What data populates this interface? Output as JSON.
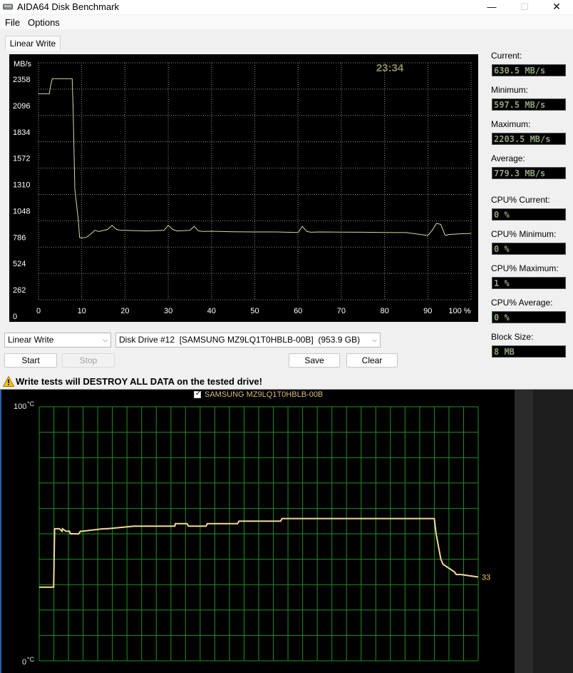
{
  "window": {
    "title": "AIDA64 Disk Benchmark",
    "minimize_glyph": "—",
    "maximize_glyph": "☐",
    "close_glyph": "✕"
  },
  "menu": {
    "file": "File",
    "options": "Options"
  },
  "tab": {
    "label": "Linear Write"
  },
  "chart_data": [
    {
      "type": "line",
      "ylabel": "MB/s",
      "timer": "23:34",
      "ylim": [
        0,
        2358
      ],
      "xlim": [
        0,
        100
      ],
      "y_ticks": [
        "2358",
        "2096",
        "1834",
        "1572",
        "1310",
        "1048",
        "786",
        "524",
        "262",
        "0"
      ],
      "x_ticks": [
        "0",
        "10",
        "20",
        "30",
        "40",
        "50",
        "60",
        "70",
        "80",
        "90",
        "100 %"
      ],
      "grid": true,
      "line_color": "#d8d8a0",
      "series": [
        {
          "x": [
            0,
            2.5,
            2.8,
            3.2,
            6,
            7.8,
            8.0,
            8.4,
            9.2,
            9.5,
            10,
            11,
            12,
            13,
            14,
            16,
            17,
            18,
            19,
            20,
            25,
            29,
            30,
            31,
            32,
            35,
            36,
            37,
            38,
            40,
            45,
            50,
            55,
            60,
            61,
            62,
            63,
            65,
            70,
            75,
            80,
            85,
            90,
            91,
            92,
            93,
            94,
            95,
            97,
            100
          ],
          "y": [
            2050,
            2050,
            2130,
            2200,
            2200,
            2200,
            1900,
            1100,
            800,
            620,
            615,
            620,
            650,
            690,
            680,
            700,
            740,
            700,
            690,
            690,
            685,
            690,
            740,
            700,
            685,
            690,
            730,
            685,
            680,
            682,
            676,
            675,
            675,
            670,
            730,
            680,
            672,
            675,
            673,
            672,
            670,
            668,
            640,
            690,
            760,
            750,
            640,
            650,
            655,
            660
          ]
        }
      ]
    },
    {
      "type": "line",
      "y_top_label": "100",
      "y_bottom_label": "0",
      "unit": "°C",
      "ylim": [
        0,
        100
      ],
      "grid": true,
      "line_color": "#f3d89a",
      "series": [
        {
          "name": "SAMSUNG MZ9LQ1T0HBLB-00B",
          "x": [
            0,
            3.3,
            3.5,
            4.6,
            5.2,
            5.3,
            6.1,
            6.9,
            7.1,
            9,
            9.4,
            9.5,
            9.8,
            14.6,
            14.8,
            15.5,
            21.6,
            21.8,
            30.9,
            31.0,
            33.7,
            34,
            38,
            38.3,
            45.2,
            45.5,
            55,
            55.3,
            89.5,
            90,
            90.4,
            91.5,
            92,
            94.6,
            95,
            96,
            100
          ],
          "y": [
            29,
            29,
            52,
            52,
            51,
            52,
            51,
            51,
            50,
            50,
            51,
            51,
            51,
            52,
            52,
            52,
            53,
            53,
            53,
            54,
            54,
            53,
            53,
            54,
            54,
            55,
            55,
            56,
            56,
            56,
            50,
            40,
            38,
            35,
            34,
            34,
            33
          ]
        }
      ],
      "current_value_label": "33"
    }
  ],
  "stats": {
    "current_label": "Current:",
    "current_value": "630.5 MB/s",
    "minimum_label": "Minimum:",
    "minimum_value": "597.5 MB/s",
    "maximum_label": "Maximum:",
    "maximum_value": "2203.5 MB/s",
    "average_label": "Average:",
    "average_value": "779.3 MB/s",
    "cpu_current_label": "CPU% Current:",
    "cpu_current_value": "0 %",
    "cpu_minimum_label": "CPU% Minimum:",
    "cpu_minimum_value": "0 %",
    "cpu_maximum_label": "CPU% Maximum:",
    "cpu_maximum_value": "1 %",
    "cpu_average_label": "CPU% Average:",
    "cpu_average_value": "0 %",
    "block_size_label": "Block Size:",
    "block_size_value": "8 MB"
  },
  "controls": {
    "test_select": "Linear Write",
    "drive_select": "Disk Drive #12  [SAMSUNG MZ9LQ1T0HBLB-00B]  (953.9 GB)",
    "start": "Start",
    "stop": "Stop",
    "save": "Save",
    "clear": "Clear"
  },
  "warning": {
    "text": "Write tests will DESTROY ALL DATA on the tested drive!"
  },
  "temperature": {
    "drive_checked": true
  }
}
